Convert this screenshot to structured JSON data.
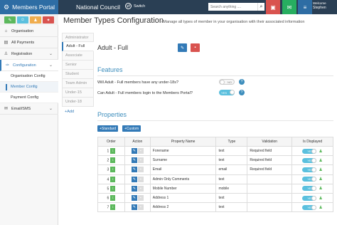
{
  "app": {
    "title": "Members Portal",
    "org_name": "National Council",
    "switch_label": "Switch"
  },
  "search": {
    "placeholder": "Search anything ...."
  },
  "user": {
    "welcome": "Welcome",
    "name": "Stephen"
  },
  "colors": {
    "topbar": "#2a3f54",
    "brand": "#2e6da4",
    "accent": "#3c8dbc",
    "success": "#5cb85c",
    "danger": "#d9534f",
    "warning": "#f0ad4e",
    "info": "#5bc0de"
  },
  "sidebar": {
    "items": [
      {
        "label": "Organisation",
        "icon": "home-icon"
      },
      {
        "label": "All Payments",
        "icon": "list-icon"
      },
      {
        "label": "Registration",
        "icon": "user-icon"
      },
      {
        "label": "Configuration",
        "icon": "wrench-icon"
      },
      {
        "label": "Email/SMS",
        "icon": "envelope-icon"
      }
    ],
    "sub_items": [
      "Organisation Config",
      "Member Config",
      "Payment Config"
    ]
  },
  "page": {
    "title": "Member Types Configuration",
    "subtitle": "Manage all types of member in your organisation with their associated information"
  },
  "member_types": [
    "Administrator",
    "Adult - Full",
    "Associate",
    "Senior",
    "Student",
    "Team Admin",
    "Under-15",
    "Under-18"
  ],
  "add_label": "Add",
  "selected_type": "Adult - Full",
  "features": {
    "title": "Features",
    "items": [
      {
        "question": "Will Adult - Full members have any under-18s?",
        "value": "NO"
      },
      {
        "question": "Can Adult - Full members login to the Members Portal?",
        "value": "YES"
      }
    ]
  },
  "properties": {
    "title": "Properties",
    "buttons": [
      "Standard",
      "Custom"
    ],
    "headers": [
      "Order",
      "Action",
      "Property Name",
      "Type",
      "Validation",
      "Is Displayed"
    ],
    "rows": [
      {
        "order": "1",
        "name": "Forename",
        "type": "text",
        "validation": "Required field",
        "displayed": "YES"
      },
      {
        "order": "2",
        "name": "Surname",
        "type": "text",
        "validation": "Required field",
        "displayed": "YES"
      },
      {
        "order": "3",
        "name": "Email",
        "type": "email",
        "validation": "Required field",
        "displayed": "YES"
      },
      {
        "order": "4",
        "name": "Admin Only Comments",
        "type": "text",
        "validation": "",
        "displayed": "YES"
      },
      {
        "order": "5",
        "name": "Mobile Number",
        "type": "mobile",
        "validation": "",
        "displayed": "YES"
      },
      {
        "order": "6",
        "name": "Address 1",
        "type": "text",
        "validation": "",
        "displayed": "YES"
      },
      {
        "order": "7",
        "name": "Address 2",
        "type": "text",
        "validation": "",
        "displayed": "YES"
      }
    ]
  }
}
